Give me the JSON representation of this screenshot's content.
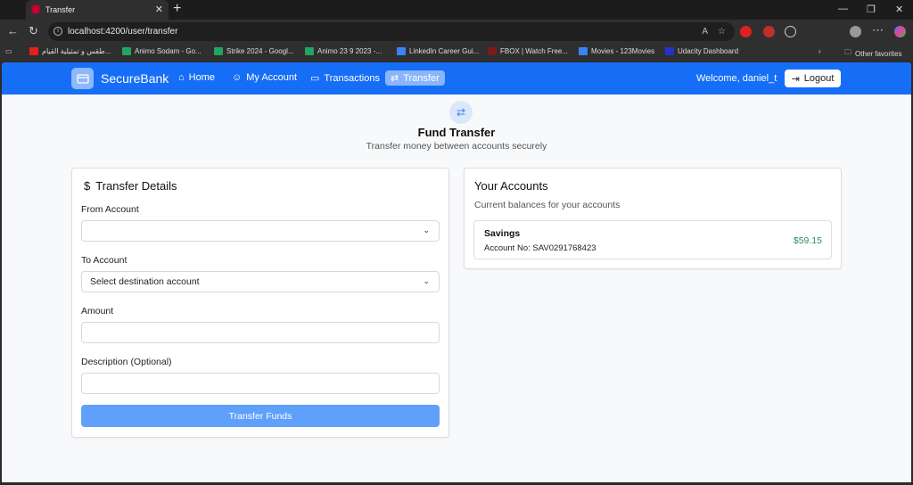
{
  "browser": {
    "tab_title": "Transfer",
    "url": "localhost:4200/user/transfer",
    "bookmarks": [
      {
        "label": "طقس و تمثيلية القيام...",
        "color": "#e62117"
      },
      {
        "label": "Animo Sodam - Go...",
        "color": "#21a464"
      },
      {
        "label": "Strike 2024 - Googl...",
        "color": "#21a464"
      },
      {
        "label": "Animo 23 9 2023 -...",
        "color": "#21a464"
      },
      {
        "label": "LinkedIn Career Gui...",
        "color": "#3b82f6"
      },
      {
        "label": "FBOX | Watch Free...",
        "color": "#7a1a1a"
      },
      {
        "label": "Movies - 123Movies",
        "color": "#3b82f6"
      },
      {
        "label": "Udacity Dashboard",
        "color": "#2233cc"
      }
    ],
    "other_favorites": "Other favorites"
  },
  "nav": {
    "brand": "SecureBank",
    "links": [
      {
        "label": "Home",
        "icon": "home-icon"
      },
      {
        "label": "My Account",
        "icon": "user-icon"
      },
      {
        "label": "Transactions",
        "icon": "card-icon"
      },
      {
        "label": "Transfer",
        "icon": "transfer-icon",
        "active": true
      }
    ],
    "welcome": "Welcome, daniel_t",
    "logout": "Logout",
    "color": "#176ef6"
  },
  "header": {
    "title": "Fund Transfer",
    "subtitle": "Transfer money between accounts securely"
  },
  "form": {
    "title": "Transfer Details",
    "from_label": "From Account",
    "from_value": "",
    "to_label": "To Account",
    "to_value": "Select destination account",
    "amount_label": "Amount",
    "amount_value": "",
    "desc_label": "Description (Optional)",
    "desc_value": "",
    "submit": "Transfer Funds"
  },
  "accounts": {
    "title": "Your Accounts",
    "subtitle": "Current balances for your accounts",
    "items": [
      {
        "name": "Savings",
        "number_label": "Account No: SAV0291768423",
        "balance": "$59.15"
      }
    ],
    "balance_color": "#2e8b57"
  }
}
